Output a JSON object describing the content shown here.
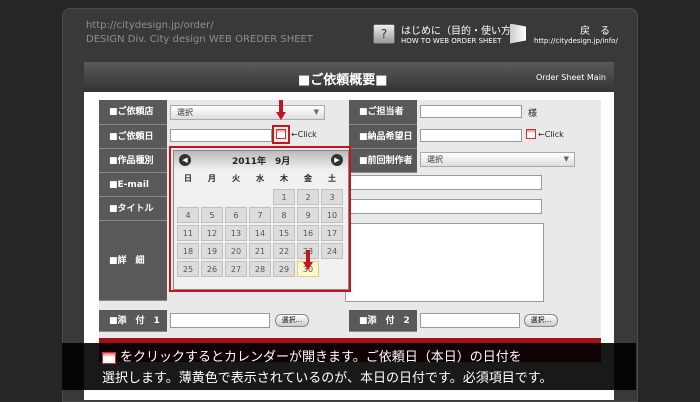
{
  "header": {
    "url": "http://citydesign.jp/order/",
    "subtitle": "DESIGN Div. City design WEB OREDER SHEET",
    "hint": {
      "title": "はじめに（目的・使い方）",
      "sub": "HOW TO WEB ORDER SHEET"
    },
    "back": {
      "title": "戻　る",
      "sub": "http://citydesign.jp/info/"
    }
  },
  "sheet": {
    "title": "■ご依頼概要■",
    "right": "Order Sheet Main"
  },
  "form": {
    "store_label": "■ご依頼店",
    "store_value": "選択",
    "contact_label": "■ご担当者",
    "contact_suffix": "様",
    "date_label": "■ご依頼日",
    "date_click": "←Click",
    "deadline_label": "■納品希望日",
    "deadline_click": "←Click",
    "type_label": "■作品種別",
    "prev_label": "■前回制作者",
    "prev_value": "選択",
    "email_label": "■E-mail",
    "title_label": "■タイトル",
    "detail_label": "■詳　細",
    "attach1_label": "■添　付　1",
    "attach2_label": "■添　付　2",
    "select_btn": "選択..."
  },
  "calendar": {
    "title": "2011年　9月",
    "prev": "◀",
    "next": "▶",
    "weekdays": [
      "日",
      "月",
      "火",
      "水",
      "木",
      "金",
      "土"
    ],
    "days": [
      "",
      "",
      "",
      "",
      "1",
      "2",
      "3",
      "4",
      "5",
      "6",
      "7",
      "8",
      "9",
      "10",
      "11",
      "12",
      "13",
      "14",
      "15",
      "16",
      "17",
      "18",
      "19",
      "20",
      "21",
      "22",
      "23",
      "24",
      "25",
      "26",
      "27",
      "28",
      "29",
      "30",
      ""
    ],
    "today": "30"
  },
  "caption": {
    "line1": "をクリックするとカレンダーが開きます。ご依頼日（本日）の日付を",
    "line2": "選択します。薄黄色で表示されているのが、本日の日付です。必須項目です。"
  },
  "colors": {
    "accent_red": "#c0161d",
    "today_bg": "#fff7cc"
  }
}
